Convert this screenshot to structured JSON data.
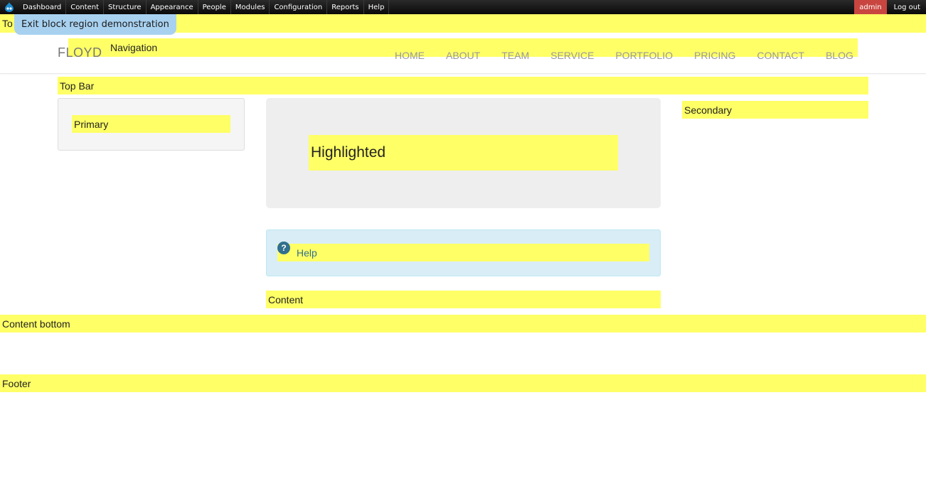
{
  "toolbar": {
    "menu": [
      "Dashboard",
      "Content",
      "Structure",
      "Appearance",
      "People",
      "Modules",
      "Configuration",
      "Reports",
      "Help"
    ],
    "user": "admin",
    "logout": "Log out"
  },
  "exit_demo": "Exit block region demonstration",
  "regions": {
    "top_clip": "To",
    "navigation": "Navigation",
    "top_bar": "Top Bar",
    "primary": "Primary",
    "highlighted": "Highlighted",
    "secondary": "Secondary",
    "help": "Help",
    "content": "Content",
    "content_bottom": "Content bottom",
    "footer": "Footer"
  },
  "site": {
    "logo": "FLOYD",
    "nav": [
      "HOME",
      "ABOUT",
      "TEAM",
      "SERVICE",
      "PORTFOLIO",
      "PRICING",
      "CONTACT",
      "BLOG"
    ]
  },
  "colors": {
    "region_highlight": "#ffff66",
    "toolbar_bg": "#111111",
    "user_badge": "#c9453f",
    "exit_button": "#a8d1f0",
    "help_bg": "#d9edf7"
  },
  "icons": {
    "home": "drupal-drop-icon",
    "help": "question-mark-icon"
  }
}
